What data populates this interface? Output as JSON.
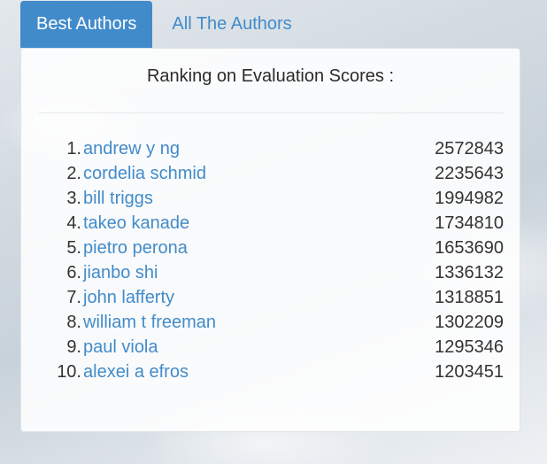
{
  "tabs": [
    {
      "label": "Best Authors",
      "active": true
    },
    {
      "label": "All The Authors",
      "active": false
    }
  ],
  "panel": {
    "title": "Ranking on Evaluation Scores :"
  },
  "ranking": [
    {
      "rank": "1.",
      "name": "andrew y ng",
      "score": "2572843"
    },
    {
      "rank": "2.",
      "name": "cordelia schmid",
      "score": "2235643"
    },
    {
      "rank": "3.",
      "name": "bill triggs",
      "score": "1994982"
    },
    {
      "rank": "4.",
      "name": "takeo kanade",
      "score": "1734810"
    },
    {
      "rank": "5.",
      "name": "pietro perona",
      "score": "1653690"
    },
    {
      "rank": "6.",
      "name": "jianbo shi",
      "score": "1336132"
    },
    {
      "rank": "7.",
      "name": "john lafferty",
      "score": "1318851"
    },
    {
      "rank": "8.",
      "name": "william t freeman",
      "score": "1302209"
    },
    {
      "rank": "9.",
      "name": "paul viola",
      "score": "1295346"
    },
    {
      "rank": "10.",
      "name": "alexei a efros",
      "score": "1203451"
    }
  ],
  "colors": {
    "accent": "#428bca",
    "text": "#333333"
  }
}
